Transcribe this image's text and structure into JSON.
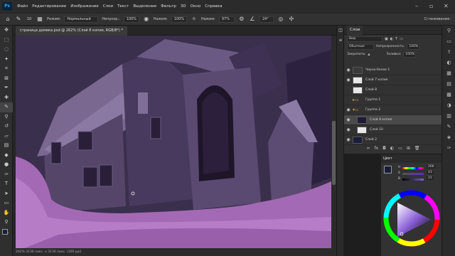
{
  "menubar": {
    "app_icon": "Ps",
    "items": [
      "Файл",
      "Редактирование",
      "Изображение",
      "Слои",
      "Текст",
      "Выделение",
      "Фильтр",
      "3D",
      "Окно",
      "Справка"
    ]
  },
  "options": {
    "brush_size": "10",
    "mode_label": "Режим:",
    "mode_value": "Нормальный",
    "opacity_label": "Непрозр.:",
    "opacity_value": "100%",
    "flow_label": "Нажим:",
    "flow_value": "100%",
    "smooth_label": "Нажим:",
    "smooth_value": "97%",
    "angle_value": "24°",
    "extra_label": "Сглаживание:"
  },
  "document": {
    "tab_title": "страница домика.psd @ 262% (Слой 8 копия, RGB/8*) *",
    "status": "262%  3136 пикс. x 3136 пикс. (300 ppi)"
  },
  "layers": {
    "panel_tab": "Слои",
    "search_placeholder": "Вид",
    "blend_mode": "Обычные",
    "opacity_label": "Непрозрачность:",
    "opacity_value": "100%",
    "lock_label": "Закрепить:",
    "fill_label": "Заливка:",
    "fill_value": "100%",
    "items": [
      {
        "name": "Черно-белое 1",
        "visible": true,
        "active": false
      },
      {
        "name": "Слой 7 копия",
        "visible": true,
        "active": false
      },
      {
        "name": "Слой 8",
        "visible": false,
        "active": false
      },
      {
        "name": "Группа 1",
        "visible": false,
        "active": false
      },
      {
        "name": "Группа 2",
        "visible": true,
        "active": false
      },
      {
        "name": "Слой 8 копия",
        "visible": true,
        "active": true
      },
      {
        "name": "Слой 10",
        "visible": true,
        "active": false
      },
      {
        "name": "Слой 2",
        "visible": true,
        "active": false
      }
    ]
  },
  "color": {
    "panel_tab": "Цвет",
    "h_value": "266",
    "s_value": "43",
    "b_value": "21",
    "fg_color": "#1a1d3a"
  }
}
